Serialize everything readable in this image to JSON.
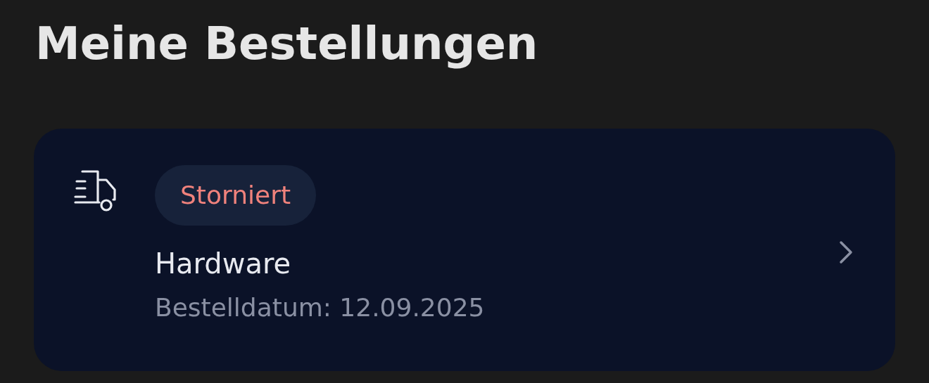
{
  "title": "Meine Bestellungen",
  "orders": [
    {
      "status": {
        "label": "Storniert",
        "kind": "cancelled"
      },
      "name": "Hardware",
      "date": "Bestelldatum: 12.09.2025"
    }
  ]
}
